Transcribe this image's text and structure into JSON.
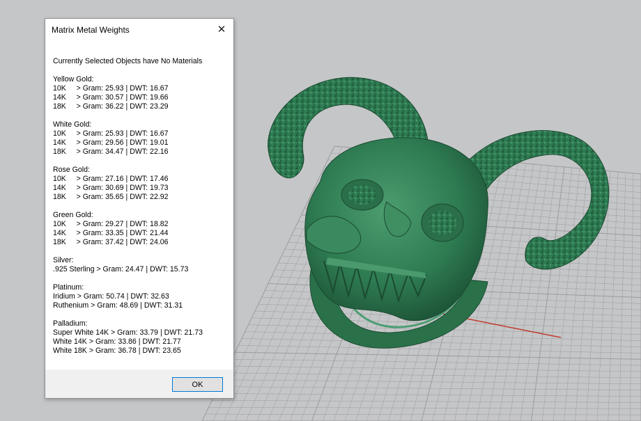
{
  "dialog": {
    "title": "Matrix Metal Weights",
    "close_icon": "close-icon",
    "subtitle": "Currently Selected Objects have No Materials",
    "groups": [
      {
        "heading": "Yellow Gold:",
        "rows": [
          "10K     > Gram: 25.93 | DWT: 16.67",
          "14K     > Gram: 30.57 | DWT: 19.66",
          "18K     > Gram: 36.22 | DWT: 23.29"
        ]
      },
      {
        "heading": "White Gold:",
        "rows": [
          "10K     > Gram: 25.93 | DWT: 16.67",
          "14K     > Gram: 29.56 | DWT: 19.01",
          "18K     > Gram: 34.47 | DWT: 22.16"
        ]
      },
      {
        "heading": "Rose Gold:",
        "rows": [
          "10K     > Gram: 27.16 | DWT: 17.46",
          "14K     > Gram: 30.69 | DWT: 19.73",
          "18K     > Gram: 35.65 | DWT: 22.92"
        ]
      },
      {
        "heading": "Green Gold:",
        "rows": [
          "10K     > Gram: 29.27 | DWT: 18.82",
          "14K     > Gram: 33.35 | DWT: 21.44",
          "18K     > Gram: 37.42 | DWT: 24.06"
        ]
      },
      {
        "heading": "Silver:",
        "rows": [
          ".925 Sterling > Gram: 24.47 | DWT: 15.73"
        ]
      },
      {
        "heading": "Platinum:",
        "rows": [
          "Iridium > Gram: 50.74 | DWT: 32.63",
          "Ruthenium > Gram: 48.69 | DWT: 31.31"
        ]
      },
      {
        "heading": "Palladium:",
        "rows": [
          "Super White 14K > Gram: 33.79 | DWT: 21.73",
          "White 14K > Gram: 33.86 | DWT: 21.77",
          "White 18K > Gram: 36.78 | DWT: 23.65"
        ]
      }
    ],
    "ok_label": "OK"
  },
  "viewport": {
    "background": "#c5c6c8",
    "grid_color": "#9a9b9d",
    "x_axis_color": "#c0392b",
    "model_color": "#2e7b52"
  }
}
